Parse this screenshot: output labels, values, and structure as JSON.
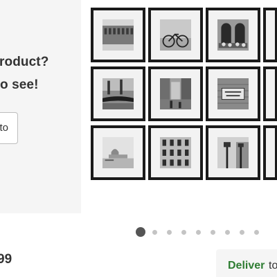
{
  "promo": {
    "line1": "roduct?",
    "line2": "o see!",
    "button_label": "to"
  },
  "gallery": {
    "photos": [
      {
        "subject": "arcade-building"
      },
      {
        "subject": "bicycle"
      },
      {
        "subject": "window-flowers"
      },
      {
        "subject": "gondolas"
      },
      {
        "subject": "canal"
      },
      {
        "subject": "via-roma-sign"
      },
      {
        "subject": "basilica"
      },
      {
        "subject": "palazzo-facade"
      },
      {
        "subject": "street-lamp"
      }
    ]
  },
  "carousel": {
    "dot_count": 9,
    "active_index": 0
  },
  "price": {
    "text": "99"
  },
  "delivery": {
    "label": "Deliver",
    "rest": "to"
  },
  "colors": {
    "deliver_green": "#2e7d32",
    "frame": "#1a1a1a",
    "mat": "#f2f2f2"
  }
}
